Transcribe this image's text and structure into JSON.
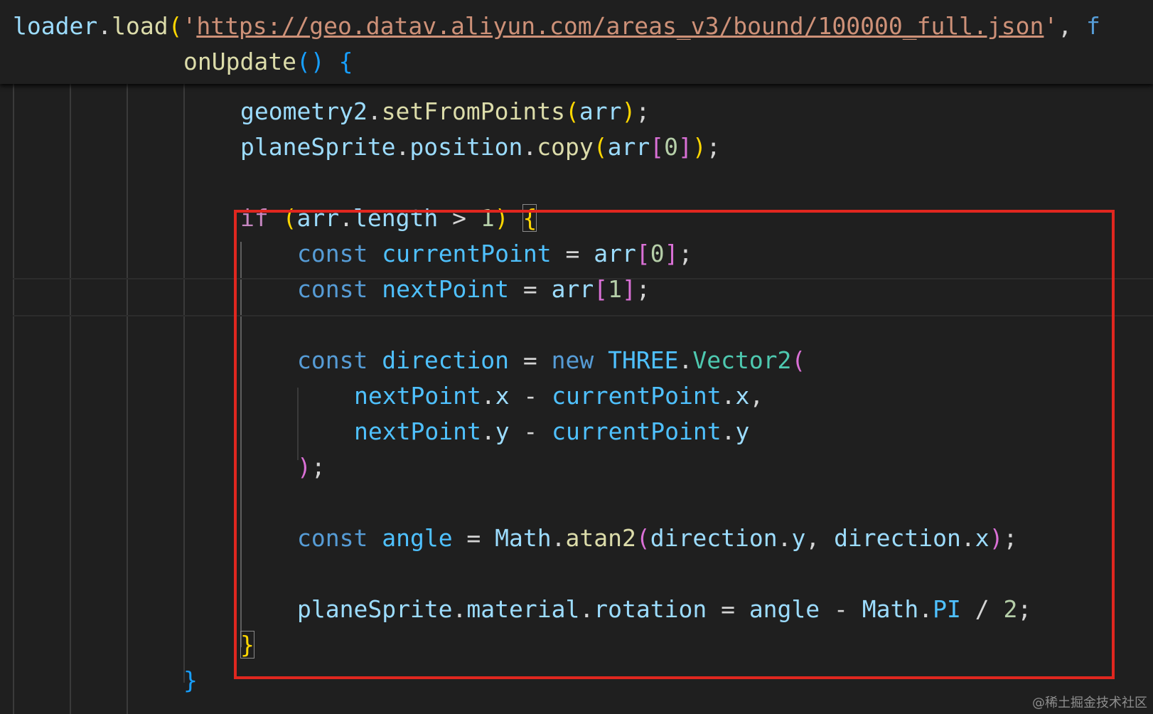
{
  "sticky_header": {
    "line1": {
      "obj": "loader",
      "dot": ".",
      "method": "load",
      "open": "(",
      "quote_open": "'",
      "url": "https://geo.datav.aliyun.com/areas_v3/bound/100000_full.json",
      "quote_close": "'",
      "comma": ", ",
      "trailing": "f"
    },
    "line2": {
      "method": "onUpdate",
      "parens": "()",
      "brace": "{"
    }
  },
  "code": {
    "l1": {
      "a": "geometry2",
      "dot": ".",
      "m": "setFromPoints",
      "op": "(",
      "arg": "arr",
      "cl": ")",
      "end": ";"
    },
    "l2": {
      "a": "planeSprite",
      "dot1": ".",
      "b": "position",
      "dot2": ".",
      "m": "copy",
      "op": "(",
      "arg": "arr",
      "ob": "[",
      "idx": "0",
      "cb": "]",
      "cl": ")",
      "end": ";"
    },
    "l3": {
      "kw": "if",
      "op": "(",
      "a": "arr",
      "dot": ".",
      "b": "length",
      "gt": " > ",
      "num": "1",
      "cl": ")",
      "brace": "{"
    },
    "l4": {
      "kw": "const",
      "name": "currentPoint",
      "eq": " = ",
      "a": "arr",
      "ob": "[",
      "idx": "0",
      "cb": "]",
      "end": ";"
    },
    "l5": {
      "kw": "const",
      "name": "nextPoint",
      "eq": " = ",
      "a": "arr",
      "ob": "[",
      "idx": "1",
      "cb": "]",
      "end": ";"
    },
    "l6": {
      "kw": "const",
      "name": "direction",
      "eq": " = ",
      "new": "new",
      "ns": "THREE",
      "dot": ".",
      "cls": "Vector2",
      "op": "("
    },
    "l7": {
      "a": "nextPoint",
      "dot1": ".",
      "b": "x",
      "minus": " - ",
      "c": "currentPoint",
      "dot2": ".",
      "d": "x",
      "comma": ","
    },
    "l8": {
      "a": "nextPoint",
      "dot1": ".",
      "b": "y",
      "minus": " - ",
      "c": "currentPoint",
      "dot2": ".",
      "d": "y"
    },
    "l9": {
      "cl": ")",
      "end": ";"
    },
    "l10": {
      "kw": "const",
      "name": "angle",
      "eq": " = ",
      "ns": "Math",
      "dot": ".",
      "m": "atan2",
      "op": "(",
      "a": "direction",
      "dot1": ".",
      "b": "y",
      "comma": ", ",
      "c": "direction",
      "dot2": ".",
      "d": "x",
      "cl": ")",
      "end": ";"
    },
    "l11": {
      "a": "planeSprite",
      "dot1": ".",
      "b": "material",
      "dot2": ".",
      "c": "rotation",
      "eq": " = ",
      "d": "angle",
      "minus": " - ",
      "ns": "Math",
      "dot3": ".",
      "e": "PI",
      "div": " / ",
      "num": "2",
      "end": ";"
    },
    "l12": {
      "brace": "}"
    },
    "l13": {
      "brace": "}"
    }
  },
  "watermark": "@稀土掘金技术社区",
  "colors": {
    "background": "#1f1f1f",
    "highlight_border": "#e0271f",
    "keyword": "#569cd6",
    "control": "#c586c0",
    "variable": "#9cdcfe",
    "function": "#dcdcaa",
    "string": "#ce9178",
    "number": "#b5cea8",
    "class": "#4ec9b0",
    "constant": "#4fc1ff"
  }
}
